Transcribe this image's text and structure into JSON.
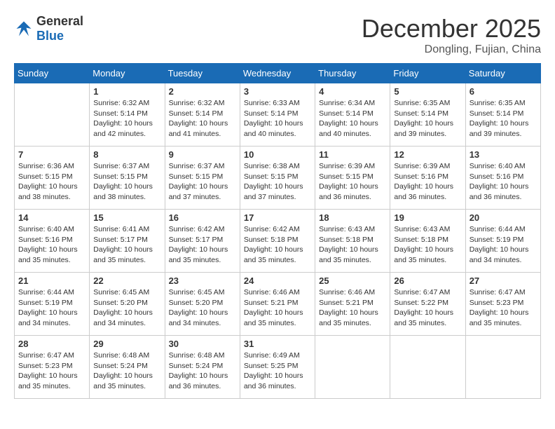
{
  "header": {
    "logo_general": "General",
    "logo_blue": "Blue",
    "month_title": "December 2025",
    "location": "Dongling, Fujian, China"
  },
  "calendar": {
    "days_of_week": [
      "Sunday",
      "Monday",
      "Tuesday",
      "Wednesday",
      "Thursday",
      "Friday",
      "Saturday"
    ],
    "weeks": [
      [
        {
          "day": "",
          "info": ""
        },
        {
          "day": "1",
          "info": "Sunrise: 6:32 AM\nSunset: 5:14 PM\nDaylight: 10 hours and 42 minutes."
        },
        {
          "day": "2",
          "info": "Sunrise: 6:32 AM\nSunset: 5:14 PM\nDaylight: 10 hours and 41 minutes."
        },
        {
          "day": "3",
          "info": "Sunrise: 6:33 AM\nSunset: 5:14 PM\nDaylight: 10 hours and 40 minutes."
        },
        {
          "day": "4",
          "info": "Sunrise: 6:34 AM\nSunset: 5:14 PM\nDaylight: 10 hours and 40 minutes."
        },
        {
          "day": "5",
          "info": "Sunrise: 6:35 AM\nSunset: 5:14 PM\nDaylight: 10 hours and 39 minutes."
        },
        {
          "day": "6",
          "info": "Sunrise: 6:35 AM\nSunset: 5:14 PM\nDaylight: 10 hours and 39 minutes."
        }
      ],
      [
        {
          "day": "7",
          "info": "Sunrise: 6:36 AM\nSunset: 5:15 PM\nDaylight: 10 hours and 38 minutes."
        },
        {
          "day": "8",
          "info": "Sunrise: 6:37 AM\nSunset: 5:15 PM\nDaylight: 10 hours and 38 minutes."
        },
        {
          "day": "9",
          "info": "Sunrise: 6:37 AM\nSunset: 5:15 PM\nDaylight: 10 hours and 37 minutes."
        },
        {
          "day": "10",
          "info": "Sunrise: 6:38 AM\nSunset: 5:15 PM\nDaylight: 10 hours and 37 minutes."
        },
        {
          "day": "11",
          "info": "Sunrise: 6:39 AM\nSunset: 5:15 PM\nDaylight: 10 hours and 36 minutes."
        },
        {
          "day": "12",
          "info": "Sunrise: 6:39 AM\nSunset: 5:16 PM\nDaylight: 10 hours and 36 minutes."
        },
        {
          "day": "13",
          "info": "Sunrise: 6:40 AM\nSunset: 5:16 PM\nDaylight: 10 hours and 36 minutes."
        }
      ],
      [
        {
          "day": "14",
          "info": "Sunrise: 6:40 AM\nSunset: 5:16 PM\nDaylight: 10 hours and 35 minutes."
        },
        {
          "day": "15",
          "info": "Sunrise: 6:41 AM\nSunset: 5:17 PM\nDaylight: 10 hours and 35 minutes."
        },
        {
          "day": "16",
          "info": "Sunrise: 6:42 AM\nSunset: 5:17 PM\nDaylight: 10 hours and 35 minutes."
        },
        {
          "day": "17",
          "info": "Sunrise: 6:42 AM\nSunset: 5:18 PM\nDaylight: 10 hours and 35 minutes."
        },
        {
          "day": "18",
          "info": "Sunrise: 6:43 AM\nSunset: 5:18 PM\nDaylight: 10 hours and 35 minutes."
        },
        {
          "day": "19",
          "info": "Sunrise: 6:43 AM\nSunset: 5:18 PM\nDaylight: 10 hours and 35 minutes."
        },
        {
          "day": "20",
          "info": "Sunrise: 6:44 AM\nSunset: 5:19 PM\nDaylight: 10 hours and 34 minutes."
        }
      ],
      [
        {
          "day": "21",
          "info": "Sunrise: 6:44 AM\nSunset: 5:19 PM\nDaylight: 10 hours and 34 minutes."
        },
        {
          "day": "22",
          "info": "Sunrise: 6:45 AM\nSunset: 5:20 PM\nDaylight: 10 hours and 34 minutes."
        },
        {
          "day": "23",
          "info": "Sunrise: 6:45 AM\nSunset: 5:20 PM\nDaylight: 10 hours and 34 minutes."
        },
        {
          "day": "24",
          "info": "Sunrise: 6:46 AM\nSunset: 5:21 PM\nDaylight: 10 hours and 35 minutes."
        },
        {
          "day": "25",
          "info": "Sunrise: 6:46 AM\nSunset: 5:21 PM\nDaylight: 10 hours and 35 minutes."
        },
        {
          "day": "26",
          "info": "Sunrise: 6:47 AM\nSunset: 5:22 PM\nDaylight: 10 hours and 35 minutes."
        },
        {
          "day": "27",
          "info": "Sunrise: 6:47 AM\nSunset: 5:23 PM\nDaylight: 10 hours and 35 minutes."
        }
      ],
      [
        {
          "day": "28",
          "info": "Sunrise: 6:47 AM\nSunset: 5:23 PM\nDaylight: 10 hours and 35 minutes."
        },
        {
          "day": "29",
          "info": "Sunrise: 6:48 AM\nSunset: 5:24 PM\nDaylight: 10 hours and 35 minutes."
        },
        {
          "day": "30",
          "info": "Sunrise: 6:48 AM\nSunset: 5:24 PM\nDaylight: 10 hours and 36 minutes."
        },
        {
          "day": "31",
          "info": "Sunrise: 6:49 AM\nSunset: 5:25 PM\nDaylight: 10 hours and 36 minutes."
        },
        {
          "day": "",
          "info": ""
        },
        {
          "day": "",
          "info": ""
        },
        {
          "day": "",
          "info": ""
        }
      ]
    ]
  }
}
